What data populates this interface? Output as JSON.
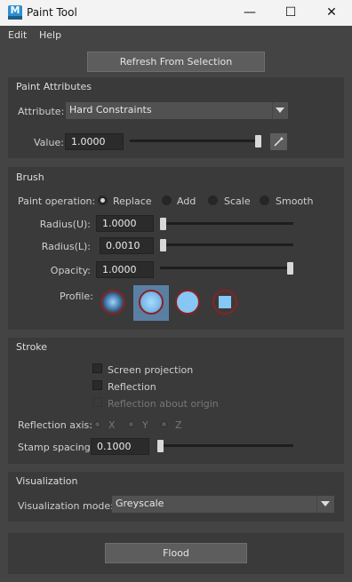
{
  "window": {
    "title": "Paint Tool",
    "icon_letter": "M",
    "minimize_glyph": "—",
    "maximize_glyph": "☐",
    "close_glyph": "✕"
  },
  "menu": {
    "items": [
      "Edit",
      "Help"
    ]
  },
  "refresh_button": "Refresh From Selection",
  "paint_attributes": {
    "title": "Paint Attributes",
    "attribute_label": "Attribute:",
    "attribute_value": "Hard Constraints",
    "value_label": "Value:",
    "value": "1.0000",
    "value_level": 1.0
  },
  "brush": {
    "title": "Brush",
    "paint_operation_label": "Paint operation:",
    "operations": [
      "Replace",
      "Add",
      "Scale",
      "Smooth"
    ],
    "selected_operation": "Replace",
    "radius_u_label": "Radius(U):",
    "radius_u": "1.0000",
    "radius_u_level": 0.0,
    "radius_l_label": "Radius(L):",
    "radius_l": "0.0010",
    "radius_l_level": 0.0,
    "opacity_label": "Opacity:",
    "opacity": "1.0000",
    "opacity_level": 1.0,
    "profile_label": "Profile:",
    "profiles": [
      "gaussian-brush-icon",
      "soft-brush-icon",
      "solid-brush-icon",
      "square-brush-icon"
    ],
    "selected_profile": 1
  },
  "stroke": {
    "title": "Stroke",
    "screen_projection": "Screen projection",
    "reflection": "Reflection",
    "reflection_about_origin": "Reflection about origin",
    "reflection_axis_label": "Reflection axis:",
    "axes": [
      "X",
      "Y",
      "Z"
    ],
    "stamp_spacing_label": "Stamp spacing:",
    "stamp_spacing": "0.1000",
    "stamp_spacing_level": 0.0
  },
  "visualization": {
    "title": "Visualization",
    "mode_label": "Visualization mode:",
    "mode_value": "Greyscale"
  },
  "flood_button": "Flood",
  "colors": {
    "panel": "#3a3a3a",
    "background": "#444444",
    "field": "#2b2b2b",
    "profile_ring": "#8a2222",
    "profile_fill": "#7fc0f0",
    "selected_profile_bg": "#5a7fa3"
  }
}
